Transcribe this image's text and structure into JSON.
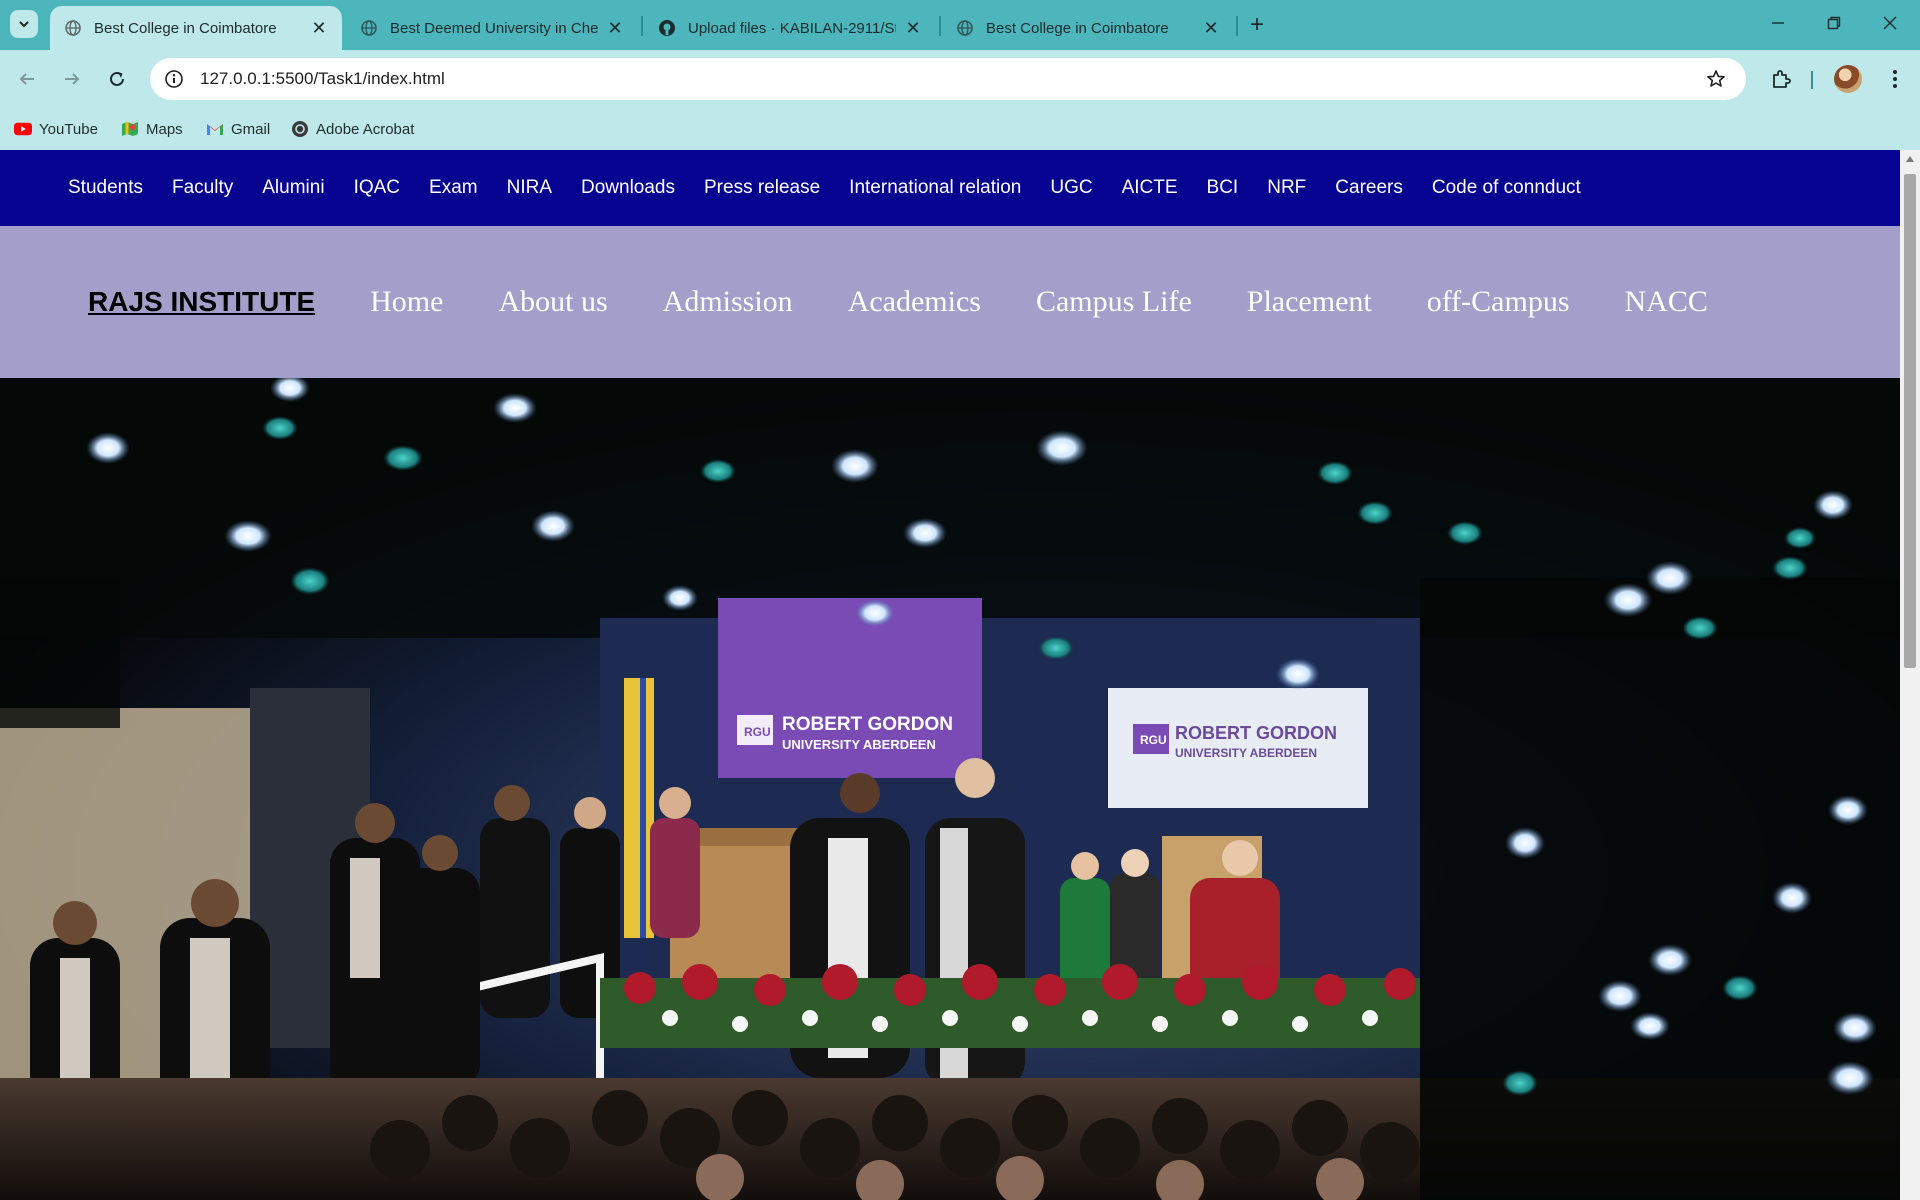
{
  "browser": {
    "tabs": [
      {
        "title": "Best College in Coimbatore",
        "active": true,
        "favicon": "globe-icon"
      },
      {
        "title": "Best Deemed University in Chen",
        "active": false,
        "favicon": "globe-icon"
      },
      {
        "title": "Upload files · KABILAN-2911/St",
        "active": false,
        "favicon": "github-icon"
      },
      {
        "title": "Best College in Coimbatore",
        "active": false,
        "favicon": "globe-icon"
      }
    ],
    "url": "127.0.0.1:5500/Task1/index.html",
    "bookmarks": [
      {
        "label": "YouTube",
        "icon": "youtube-icon"
      },
      {
        "label": "Maps",
        "icon": "maps-icon"
      },
      {
        "label": "Gmail",
        "icon": "gmail-icon"
      },
      {
        "label": "Adobe Acrobat",
        "icon": "acrobat-icon"
      }
    ],
    "colors": {
      "tabstrip": "#4cb6bc",
      "toolbar": "#bfe8ea"
    }
  },
  "page": {
    "top_nav": [
      "Students",
      "Faculty",
      "Alumini",
      "IQAC",
      "Exam",
      "NIRA",
      "Downloads",
      "Press release",
      "International relation",
      "UGC",
      "AICTE",
      "BCI",
      "NRF",
      "Careers",
      "Code of connduct"
    ],
    "brand": "RAJS INSTITUTE",
    "main_nav": [
      "Home",
      "About us",
      "Admission",
      "Academics",
      "Campus Life",
      "Placement",
      "off-Campus",
      "NACC"
    ],
    "hero": {
      "banner_left": "ROBERT GORDON",
      "banner_left_sub": "UNIVERSITY ABERDEEN",
      "banner_right": "ROBERT GORDON",
      "banner_right_sub": "UNIVERSITY ABERDEEN",
      "logo_text": "RGU"
    },
    "colors": {
      "top_nav_bg": "#060391",
      "main_nav_bg": "#a39fca"
    }
  }
}
